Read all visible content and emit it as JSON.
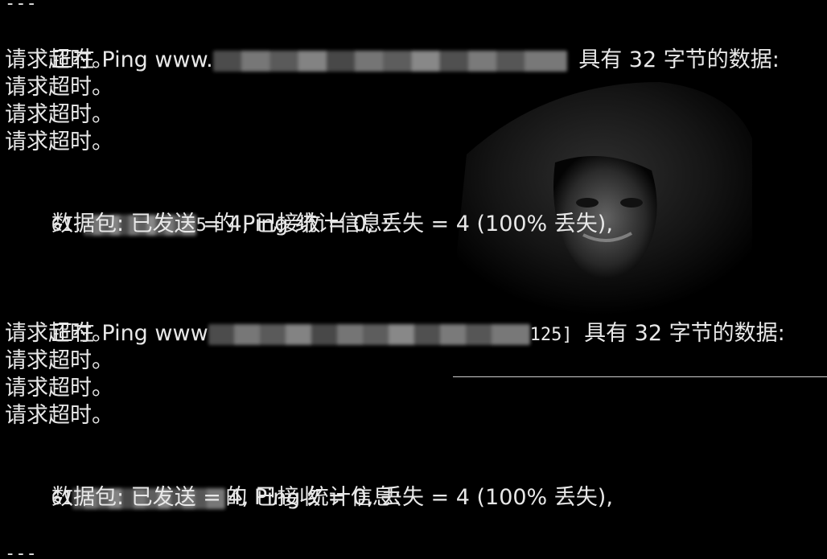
{
  "console": {
    "top_separator": "---",
    "block1": {
      "ping_prefix": "正在 Ping www.",
      "ping_suffix": "具有 32 字节的数据:",
      "timeouts": [
        "请求超时。",
        "请求超时。",
        "请求超时。",
        "请求超时。"
      ],
      "stats_ip_prefix": "61.",
      "stats_ip_suffix": "5",
      "stats_title": " 的 Ping 统计信息:",
      "packets": "数据包: 已发送 = 4, 已接收 = 0, 丢失 = 4 (100% 丢失),"
    },
    "block2": {
      "ping_prefix": "正在 Ping www",
      "ping_mid": "125]",
      "ping_suffix": "具有 32 字节的数据:",
      "timeouts": [
        "请求超时。",
        "请求超时。",
        "请求超时。",
        "请求超时。"
      ],
      "stats_ip_prefix": "61",
      "stats_title": "的 Ping 统计信息:",
      "packets": "数据包: 已发送 = 4, 已接收 = 0, 丢失 = 4 (100% 丢失),"
    },
    "bottom_separator": "---"
  }
}
